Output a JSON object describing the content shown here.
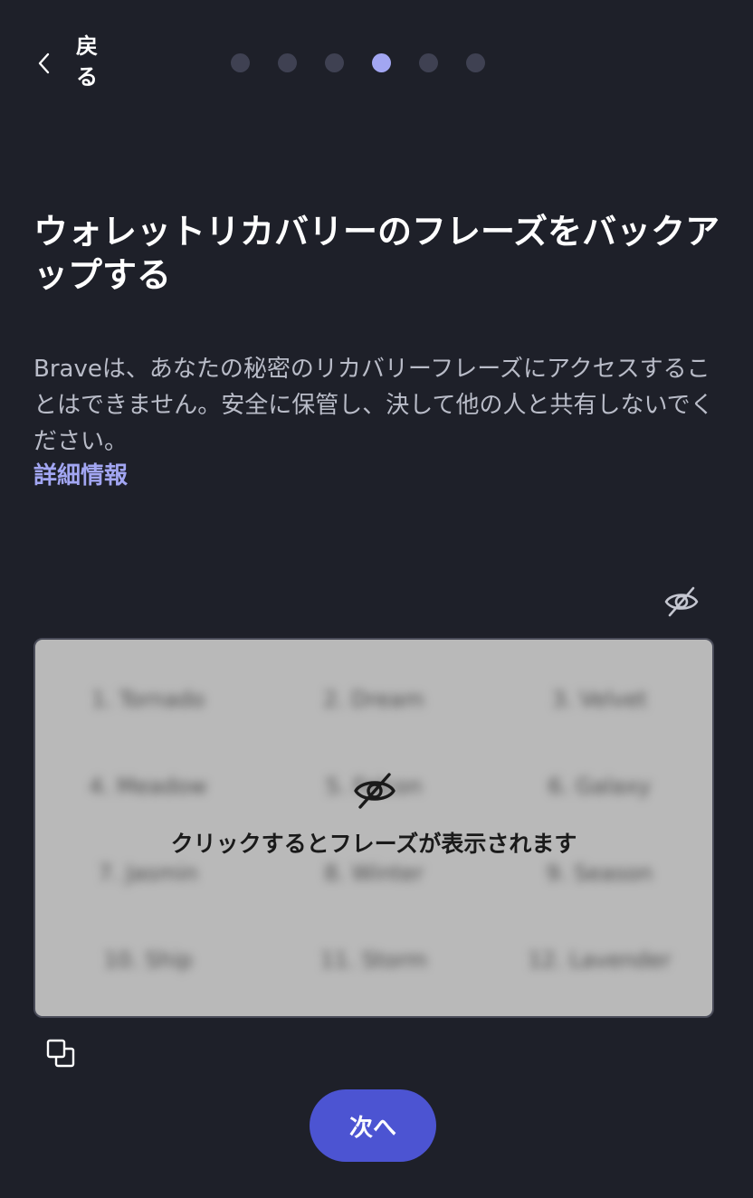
{
  "header": {
    "back_label": "戻る",
    "back_icon": "chevron-left-icon",
    "steps_total": 6,
    "active_step": 4
  },
  "main": {
    "title": "ウォレットリカバリーのフレーズをバックアップする",
    "description": "Braveは、あなたの秘密のリカバリーフレーズにアクセスすることはできません。安全に保管し、決して他の人と共有しないでください。",
    "learn_more": "詳細情報"
  },
  "phrase": {
    "toggle_icon": "eye-off-icon",
    "overlay_text": "クリックするとフレーズが表示されます",
    "blurred_words": [
      "1. Tornado",
      "2. Dream",
      "3. Velvet",
      "4. Meadow",
      "5. Falcon",
      "6. Galaxy",
      "7. Jasmin",
      "8. Winter",
      "9. Season",
      "10. Ship",
      "11. Storm",
      "12. Lavender"
    ],
    "copy_icon": "copy-icon"
  },
  "footer": {
    "next_label": "次へ"
  },
  "colors": {
    "background": "#1e2029",
    "accent": "#a2a6f2",
    "primary_button": "#4c54d2",
    "dot_inactive": "#3f4152",
    "phrase_box": "#b9b9b9"
  }
}
